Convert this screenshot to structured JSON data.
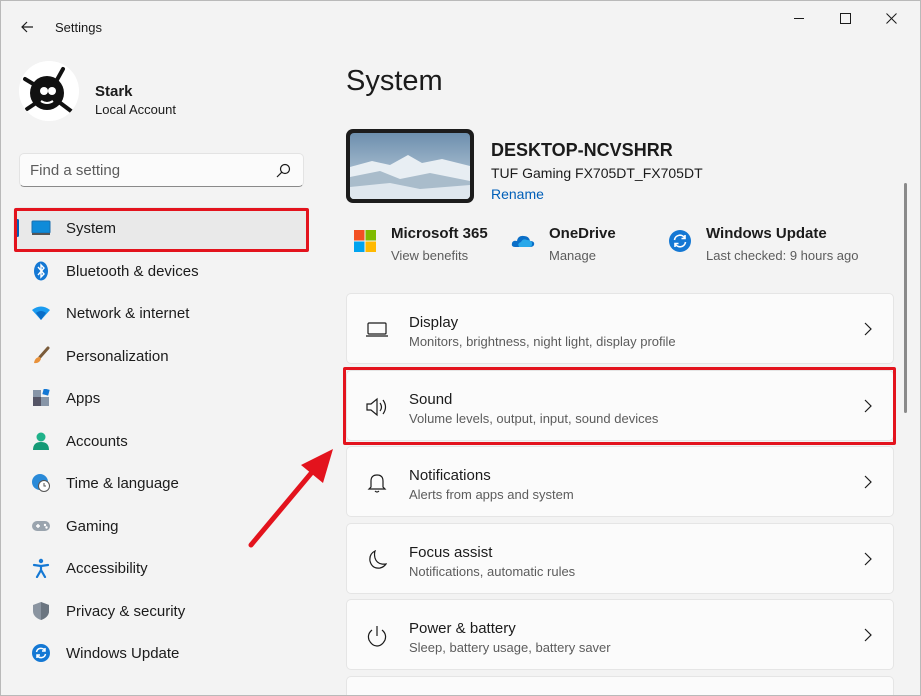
{
  "window": {
    "title": "Settings"
  },
  "user": {
    "name": "Stark",
    "account_type": "Local Account"
  },
  "search": {
    "placeholder": "Find a setting"
  },
  "nav": {
    "items": [
      {
        "label": "System",
        "icon": "monitor-icon",
        "active": true
      },
      {
        "label": "Bluetooth & devices",
        "icon": "bluetooth-icon"
      },
      {
        "label": "Network & internet",
        "icon": "wifi-icon"
      },
      {
        "label": "Personalization",
        "icon": "brush-icon"
      },
      {
        "label": "Apps",
        "icon": "apps-icon"
      },
      {
        "label": "Accounts",
        "icon": "person-icon"
      },
      {
        "label": "Time & language",
        "icon": "globe-clock-icon"
      },
      {
        "label": "Gaming",
        "icon": "gamepad-icon"
      },
      {
        "label": "Accessibility",
        "icon": "accessibility-icon"
      },
      {
        "label": "Privacy & security",
        "icon": "shield-icon"
      },
      {
        "label": "Windows Update",
        "icon": "update-icon"
      }
    ]
  },
  "main": {
    "title": "System",
    "device": {
      "name": "DESKTOP-NCVSHRR",
      "model": "TUF Gaming FX705DT_FX705DT",
      "rename_label": "Rename"
    },
    "quick_links": [
      {
        "title": "Microsoft 365",
        "subtitle": "View benefits",
        "icon": "microsoft-logo-icon"
      },
      {
        "title": "OneDrive",
        "subtitle": "Manage",
        "icon": "cloud-icon"
      },
      {
        "title": "Windows Update",
        "subtitle": "Last checked: 9 hours ago",
        "icon": "update-icon"
      }
    ],
    "cards": [
      {
        "title": "Display",
        "subtitle": "Monitors, brightness, night light, display profile",
        "icon": "display-icon"
      },
      {
        "title": "Sound",
        "subtitle": "Volume levels, output, input, sound devices",
        "icon": "speaker-icon"
      },
      {
        "title": "Notifications",
        "subtitle": "Alerts from apps and system",
        "icon": "bell-icon"
      },
      {
        "title": "Focus assist",
        "subtitle": "Notifications, automatic rules",
        "icon": "moon-icon"
      },
      {
        "title": "Power & battery",
        "subtitle": "Sleep, battery usage, battery saver",
        "icon": "power-icon"
      }
    ]
  },
  "colors": {
    "accent": "#005fb8",
    "highlight_red": "#e3131d",
    "background": "#f3f3f3"
  }
}
